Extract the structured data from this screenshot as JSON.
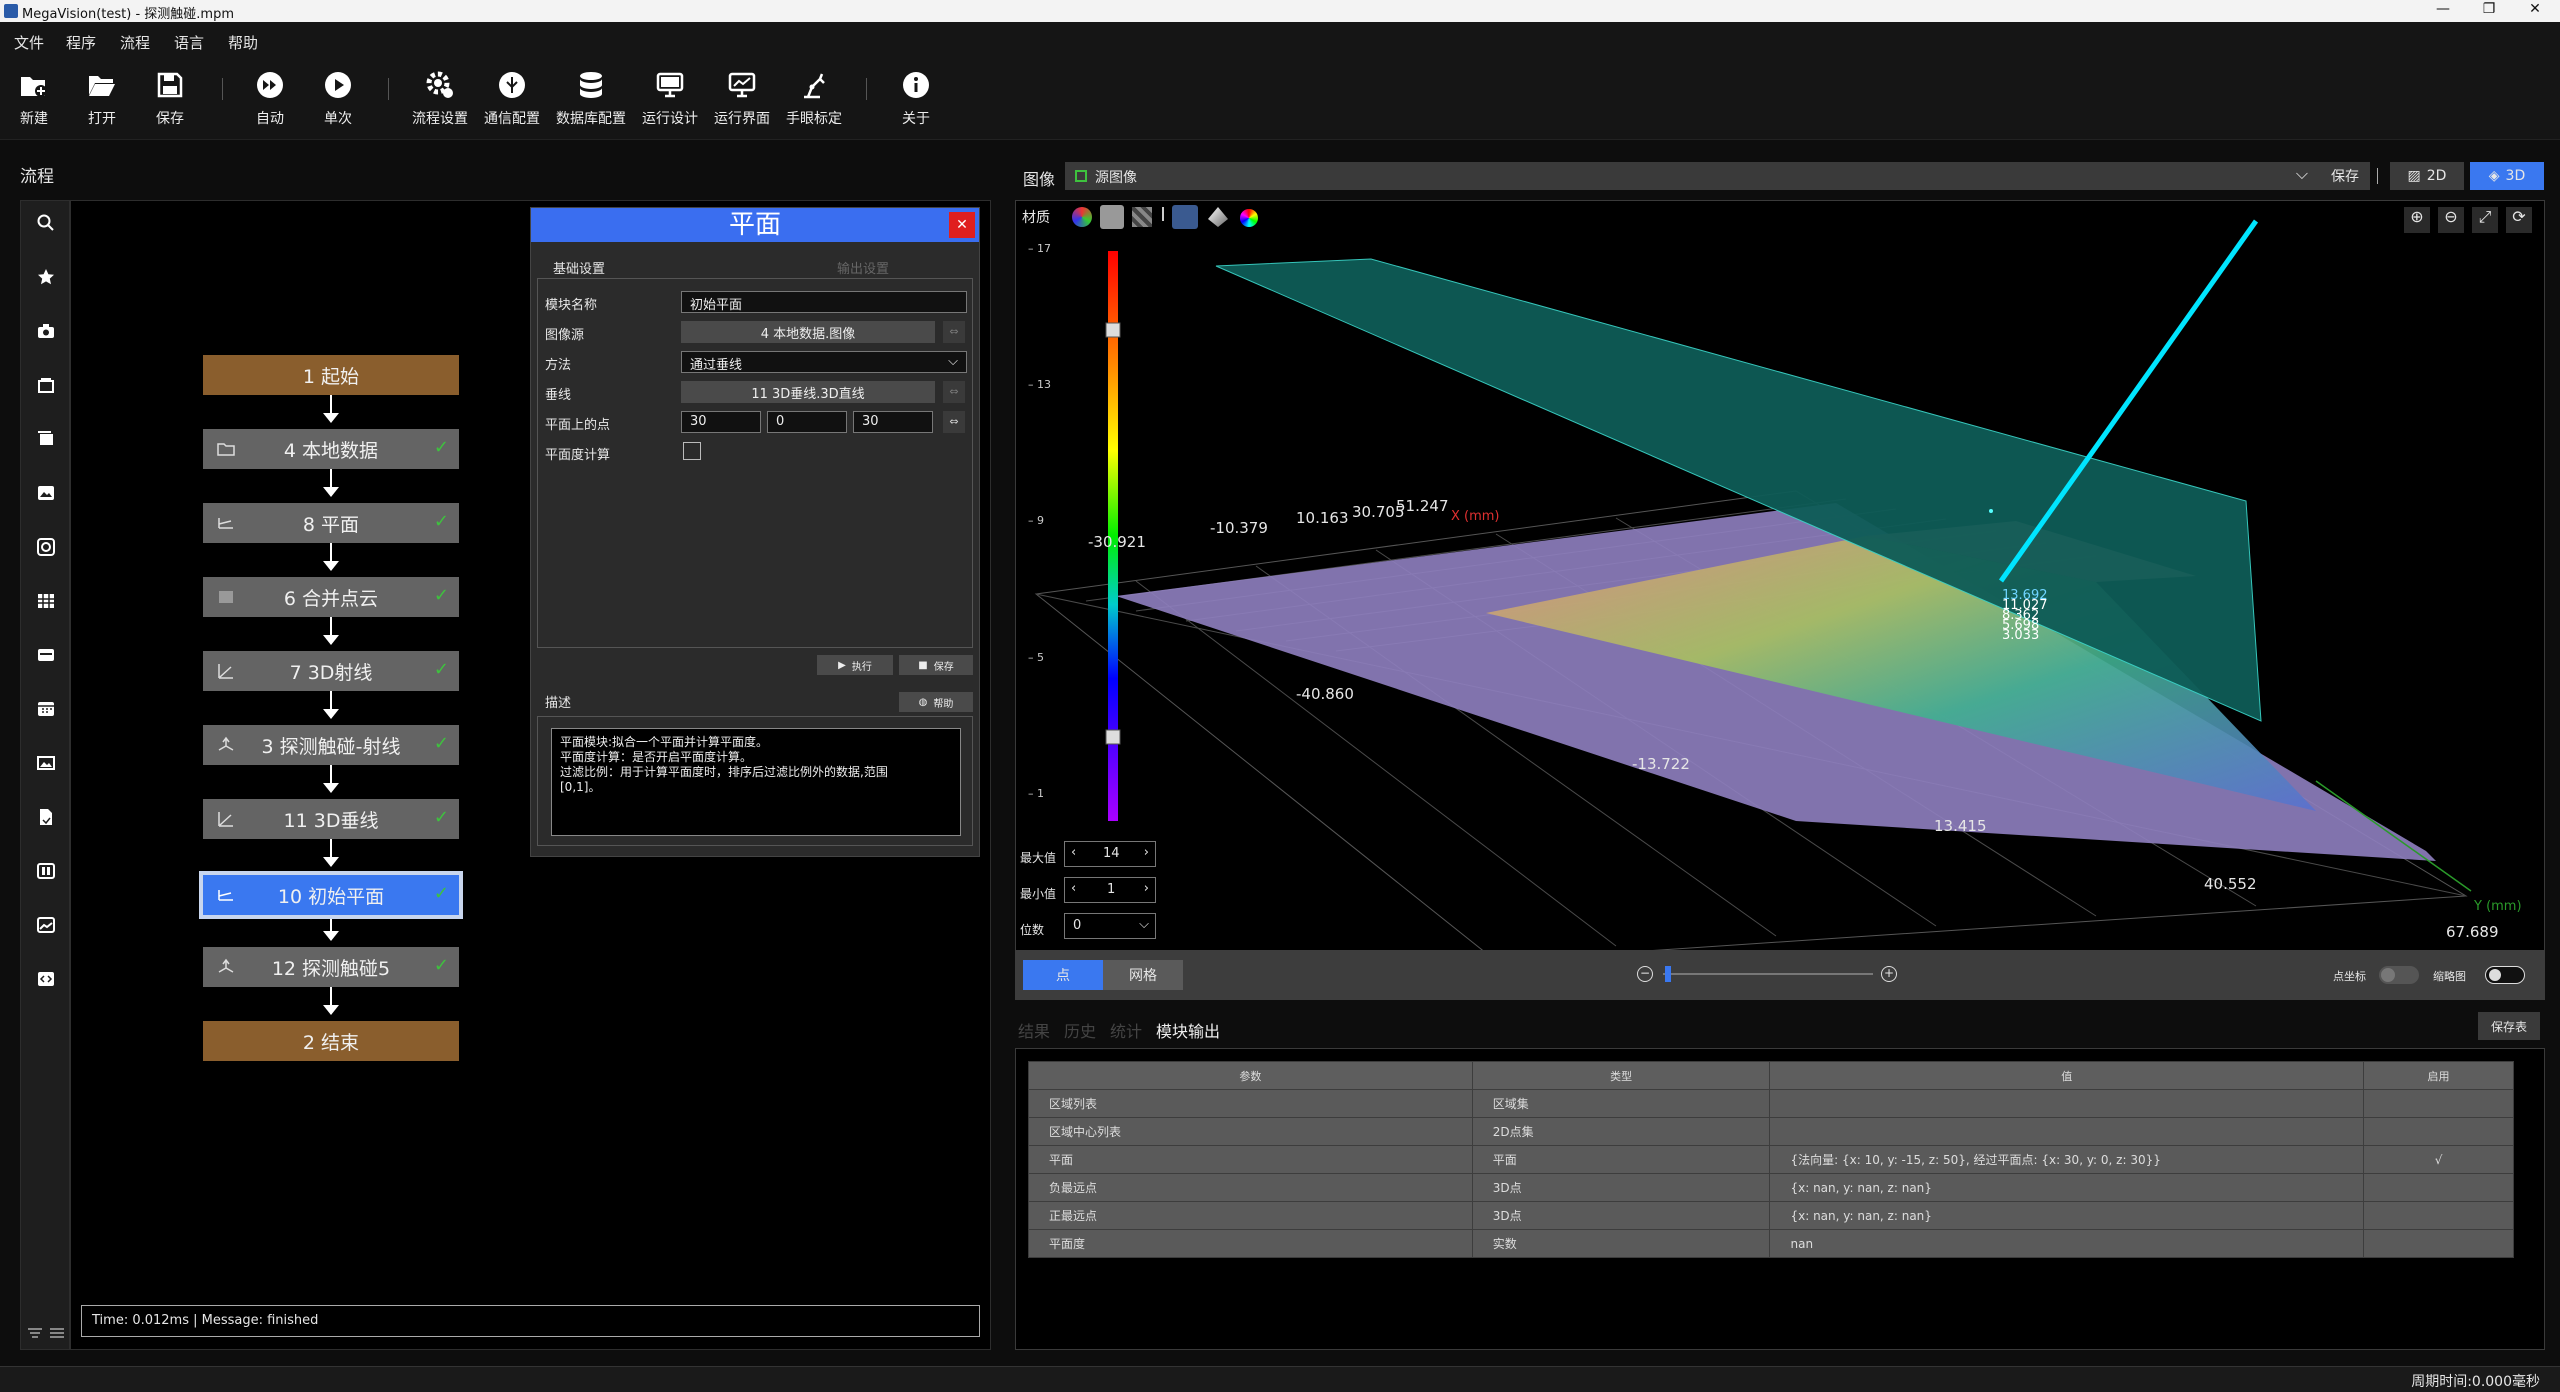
{
  "window": {
    "title": "MegaVision(test) - 探测触碰.mpm"
  },
  "menu": [
    "文件",
    "程序",
    "流程",
    "语言",
    "帮助"
  ],
  "toolbar": {
    "new": "新建",
    "open": "打开",
    "save": "保存",
    "auto": "自动",
    "single": "单次",
    "flow_settings": "流程设置",
    "comm_config": "通信配置",
    "db_config": "数据库配置",
    "run_design": "运行设计",
    "run_ui": "运行界面",
    "hand_eye": "手眼标定",
    "about": "关于"
  },
  "left": {
    "title": "流程"
  },
  "flow": {
    "nodes": [
      {
        "label": "1 起始"
      },
      {
        "label": "4 本地数据"
      },
      {
        "label": "8 平面"
      },
      {
        "label": "6 合并点云"
      },
      {
        "label": "7 3D射线"
      },
      {
        "label": "3 探测触碰-射线"
      },
      {
        "label": "11 3D垂线"
      },
      {
        "label": "10 初始平面"
      },
      {
        "label": "12 探测触碰5"
      },
      {
        "label": "2 结束"
      }
    ],
    "status": "Time: 0.012ms |  Message: finished"
  },
  "dialog": {
    "title": "平面",
    "tab_basic": "基础设置",
    "tab_output": "输出设置",
    "module_name_label": "模块名称",
    "module_name_value": "初始平面",
    "image_source_label": "图像源",
    "image_source_value": "4 本地数据.图像",
    "method_label": "方法",
    "method_value": "通过垂线",
    "perp_label": "垂线",
    "perp_value": "11 3D垂线.3D直线",
    "point_label": "平面上的点",
    "point_x": "30",
    "point_y": "0",
    "point_z": "30",
    "flatness_label": "平面度计算",
    "exec_btn": "执行",
    "save_btn": "保存",
    "desc_label": "描述",
    "help_btn": "帮助",
    "desc_line1": "平面模块:拟合一个平面并计算平面度。",
    "desc_line2": "平面度计算：是否开启平面度计算。",
    "desc_line3": "过滤比例：用于计算平面度时，排序后过滤比例外的数据,范围",
    "desc_line4": "[0,1]。"
  },
  "viewer": {
    "image_label": "图像",
    "source": "源图像",
    "save": "保存",
    "btn_2d": "2D",
    "btn_3d": "3D",
    "material": "材质",
    "colorbar_ticks": [
      "17",
      "13",
      "9",
      "5",
      "1"
    ],
    "colorbar_ticks_y": [
      17,
      13,
      9,
      5,
      1
    ],
    "axis_labels": {
      "x": "X (mm)",
      "y": "Y (mm)"
    },
    "x_ticks": [
      "-30.921",
      "-10.379",
      "10.163",
      "30.705",
      "51.247"
    ],
    "y_ticks": [
      "-40.860",
      "-13.722",
      "13.415",
      "40.552",
      "67.689"
    ],
    "z_values": [
      "13.692",
      "11.027",
      "8.362",
      "5.698",
      "3.033"
    ],
    "max_label": "最大值",
    "max_value": "14",
    "min_label": "最小值",
    "min_value": "1",
    "digits_label": "位数",
    "digits_value": "0",
    "tab_point": "点",
    "tab_mesh": "网格",
    "point_coord": "点坐标",
    "thumbnail": "缩略图"
  },
  "results": {
    "tabs": [
      "结果",
      "历史",
      "统计",
      "模块输出"
    ],
    "save_table": "保存表",
    "headers": [
      "参数",
      "类型",
      "值",
      "启用"
    ],
    "rows": [
      [
        "区域列表",
        "区域集",
        "",
        ""
      ],
      [
        "区域中心列表",
        "2D点集",
        "",
        ""
      ],
      [
        "平面",
        "平面",
        "{法向量: {x: 10, y: -15, z: 50}, 经过平面点: {x: 30, y: 0, z: 30}}",
        "√"
      ],
      [
        "负最远点",
        "3D点",
        "{x: nan, y: nan, z: nan}",
        ""
      ],
      [
        "正最远点",
        "3D点",
        "{x: nan, y: nan, z: nan}",
        ""
      ],
      [
        "平面度",
        "实数",
        "nan",
        ""
      ]
    ]
  },
  "footer": {
    "cycle_time": "周期时间:0.000毫秒"
  },
  "colors": {
    "accent": "#3a78f0",
    "terminal": "#8a5e2d",
    "node": "#646464",
    "check": "#3ec23e"
  }
}
